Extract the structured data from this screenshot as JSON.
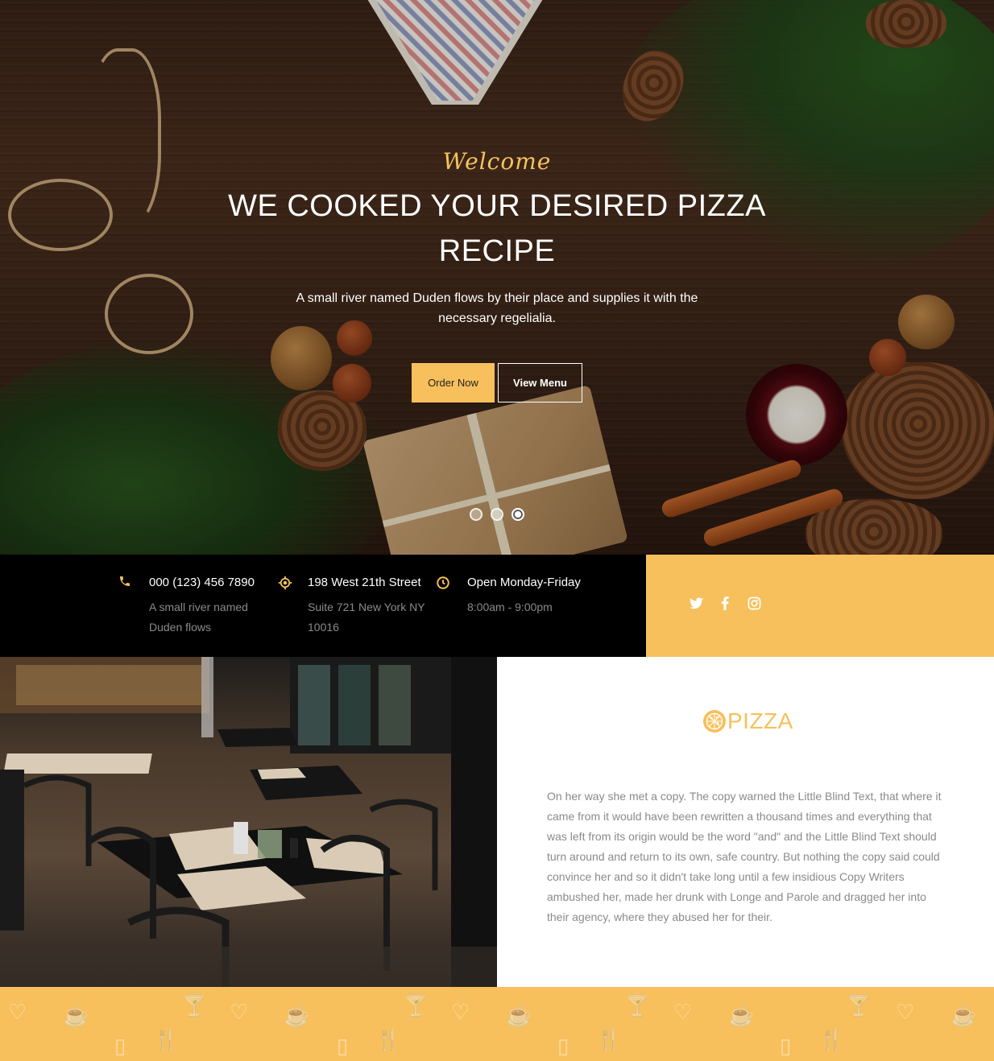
{
  "hero": {
    "welcome": "Welcome",
    "headline": "WE COOKED YOUR DESIRED PIZZA RECIPE",
    "subtext": "A small river named Duden flows by their place and supplies it with the necessary regelialia.",
    "order_button": "Order Now",
    "menu_button": "View Menu",
    "slider_dots": [
      {
        "active": false
      },
      {
        "active": false
      },
      {
        "active": true
      }
    ]
  },
  "info": {
    "phone": {
      "icon": "phone-icon",
      "title": "000 (123) 456 7890",
      "sub": "A small river named Duden flows"
    },
    "address": {
      "icon": "location-icon",
      "title": "198 West 21th Street",
      "sub": "Suite 721 New York NY 10016"
    },
    "hours": {
      "icon": "clock-icon",
      "title": "Open Monday-Friday",
      "sub": "8:00am - 9:00pm"
    }
  },
  "social": {
    "items": [
      {
        "icon": "twitter-icon"
      },
      {
        "icon": "facebook-icon"
      },
      {
        "icon": "instagram-icon"
      }
    ]
  },
  "about": {
    "logo_word": "PIZZA",
    "paragraph": "On her way she met a copy. The copy warned the Little Blind Text, that where it came from it would have been rewritten a thousand times and everything that was left from its origin would be the word \"and\" and the Little Blind Text should turn around and return to its own, safe country. But nothing the copy said could convince her and so it didn't take long until a few insidious Copy Writers ambushed her, made her drunk with Longe and Parole and dragged her into their agency, where they abused her for their."
  },
  "colors": {
    "accent": "#f7c05c",
    "dark": "#000000",
    "muted_text": "#8a8a8a"
  }
}
